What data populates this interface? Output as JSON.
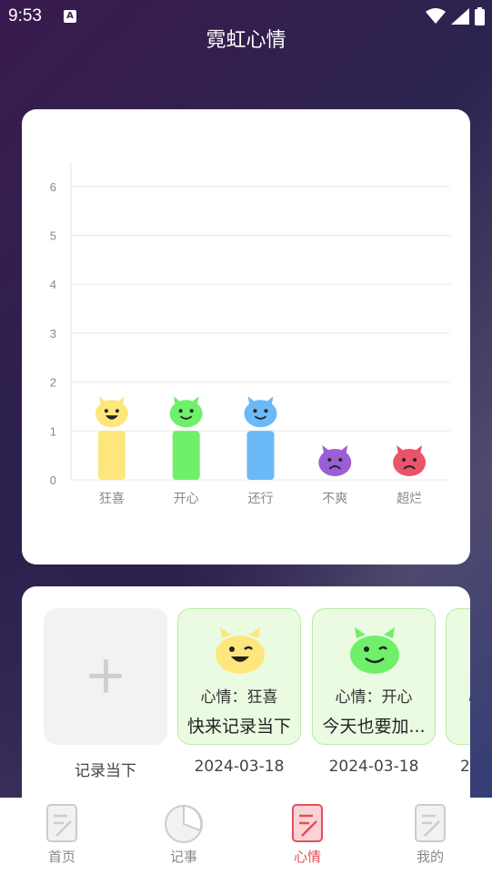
{
  "status_bar": {
    "time": "9:53",
    "icons": [
      "a-notification-icon",
      "wifi-icon",
      "signal-icon",
      "battery-icon"
    ]
  },
  "app_title": "霓虹心情",
  "chart_data": {
    "type": "bar",
    "categories": [
      "狂喜",
      "开心",
      "还行",
      "不爽",
      "超烂"
    ],
    "values": [
      1,
      1,
      1,
      0,
      0
    ],
    "colors": [
      "#fde77c",
      "#6ff06a",
      "#6bb9f7",
      "#9a5ed6",
      "#e95469"
    ],
    "ylim": [
      0,
      6.5
    ],
    "yticks": [
      0,
      1,
      2,
      3,
      4,
      5,
      6
    ],
    "grid": true
  },
  "records": {
    "add_caption": "记录当下",
    "items": [
      {
        "mood_label": "心情：狂喜",
        "text": "快来记录当下",
        "date": "2024-03-18",
        "face": "yellow"
      },
      {
        "mood_label": "心情：开心",
        "text": "今天也要加...",
        "date": "2024-03-18",
        "face": "green"
      },
      {
        "mood_label": "心",
        "text": "",
        "date": "2",
        "face": "green"
      }
    ]
  },
  "tabs": [
    {
      "label": "首页",
      "icon": "document-icon",
      "active": false
    },
    {
      "label": "记事",
      "icon": "pie-chart-icon",
      "active": false
    },
    {
      "label": "心情",
      "icon": "edit-note-icon",
      "active": true
    },
    {
      "label": "我的",
      "icon": "document-icon",
      "active": false
    }
  ]
}
